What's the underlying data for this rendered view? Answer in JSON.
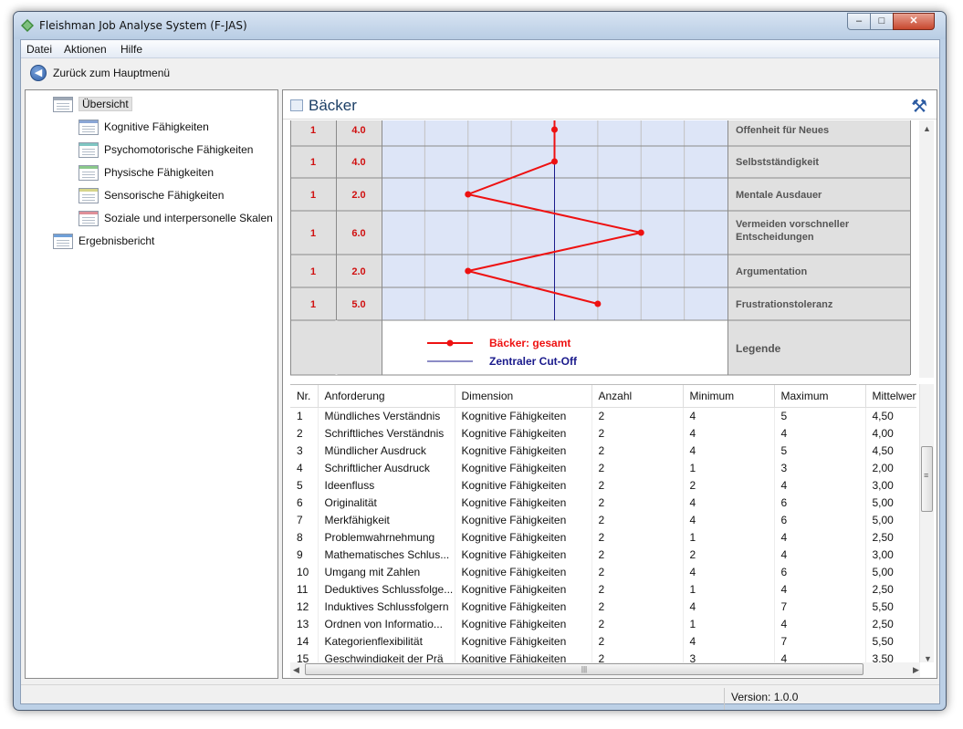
{
  "window": {
    "title": "Fleishman Job Analyse System (F-JAS)",
    "minimize": "–",
    "maximize": "□",
    "close": "✕"
  },
  "menu": [
    "Datei",
    "Aktionen",
    "Hilfe"
  ],
  "toolbar": {
    "back_label": "Zurück zum Hauptmenü",
    "back_icon": "arrow-left-circle-icon"
  },
  "tree": {
    "overview": "Übersicht",
    "items": [
      {
        "label": "Kognitive Fähigkeiten",
        "color": "#8aa6d6"
      },
      {
        "label": "Psychomotorische Fähigkeiten",
        "color": "#7fc6c2"
      },
      {
        "label": "Physische Fähigkeiten",
        "color": "#8bc98b"
      },
      {
        "label": "Sensorische Fähigkeiten",
        "color": "#d6d58a"
      },
      {
        "label": "Soziale und interpersonelle Skalen",
        "color": "#df8f98"
      }
    ],
    "report": "Ergebnisbericht"
  },
  "main": {
    "title": "Bäcker",
    "tools_icon": "tools-icon"
  },
  "chart_data": {
    "type": "line",
    "rows": [
      {
        "n": "1",
        "value": "4.0",
        "label": "Offenheit für Neues"
      },
      {
        "n": "1",
        "value": "4.0",
        "label": "Selbstständigkeit"
      },
      {
        "n": "1",
        "value": "2.0",
        "label": "Mentale Ausdauer"
      },
      {
        "n": "1",
        "value": "6.0",
        "label": "Vermeiden vorschneller Entscheidungen"
      },
      {
        "n": "1",
        "value": "2.0",
        "label": "Argumentation"
      },
      {
        "n": "1",
        "value": "5.0",
        "label": "Frustrationstoleranz"
      }
    ],
    "values": [
      4.0,
      4.0,
      2.0,
      6.0,
      2.0,
      5.0
    ],
    "xlim": [
      0,
      8
    ],
    "cutoff": 4.0,
    "legend_title": "Legende",
    "series": [
      {
        "name": "Bäcker: gesamt",
        "color": "#ee1111"
      }
    ],
    "cutoff_label": "Zentraler Cut-Off",
    "cutoff_color": "#1a1a8c"
  },
  "table": {
    "columns": [
      "Nr.",
      "Anforderung",
      "Dimension",
      "Anzahl",
      "Minimum",
      "Maximum",
      "Mittelwert"
    ],
    "rows": [
      [
        "1",
        "Mündliches Verständnis",
        "Kognitive Fähigkeiten",
        "2",
        "4",
        "5",
        "4,50"
      ],
      [
        "2",
        "Schriftliches Verständnis",
        "Kognitive Fähigkeiten",
        "2",
        "4",
        "4",
        "4,00"
      ],
      [
        "3",
        "Mündlicher Ausdruck",
        "Kognitive Fähigkeiten",
        "2",
        "4",
        "5",
        "4,50"
      ],
      [
        "4",
        "Schriftlicher Ausdruck",
        "Kognitive Fähigkeiten",
        "2",
        "1",
        "3",
        "2,00"
      ],
      [
        "5",
        "Ideenfluss",
        "Kognitive Fähigkeiten",
        "2",
        "2",
        "4",
        "3,00"
      ],
      [
        "6",
        "Originalität",
        "Kognitive Fähigkeiten",
        "2",
        "4",
        "6",
        "5,00"
      ],
      [
        "7",
        "Merkfähigkeit",
        "Kognitive Fähigkeiten",
        "2",
        "4",
        "6",
        "5,00"
      ],
      [
        "8",
        "Problemwahrnehmung",
        "Kognitive Fähigkeiten",
        "2",
        "1",
        "4",
        "2,50"
      ],
      [
        "9",
        "Mathematisches Schlus...",
        "Kognitive Fähigkeiten",
        "2",
        "2",
        "4",
        "3,00"
      ],
      [
        "10",
        "Umgang mit Zahlen",
        "Kognitive Fähigkeiten",
        "2",
        "4",
        "6",
        "5,00"
      ],
      [
        "11",
        "Deduktives Schlussfolge...",
        "Kognitive Fähigkeiten",
        "2",
        "1",
        "4",
        "2,50"
      ],
      [
        "12",
        "Induktives Schlussfolgern",
        "Kognitive Fähigkeiten",
        "2",
        "4",
        "7",
        "5,50"
      ],
      [
        "13",
        "Ordnen von Informatio...",
        "Kognitive Fähigkeiten",
        "2",
        "1",
        "4",
        "2,50"
      ],
      [
        "14",
        "Kategorienflexibilität",
        "Kognitive Fähigkeiten",
        "2",
        "4",
        "7",
        "5,50"
      ],
      [
        "15",
        "Geschwindigkeit der Prä",
        "Kognitive Fähigkeiten",
        "2",
        "3",
        "4",
        "3,50"
      ]
    ]
  },
  "status": {
    "version": "Version: 1.0.0"
  }
}
